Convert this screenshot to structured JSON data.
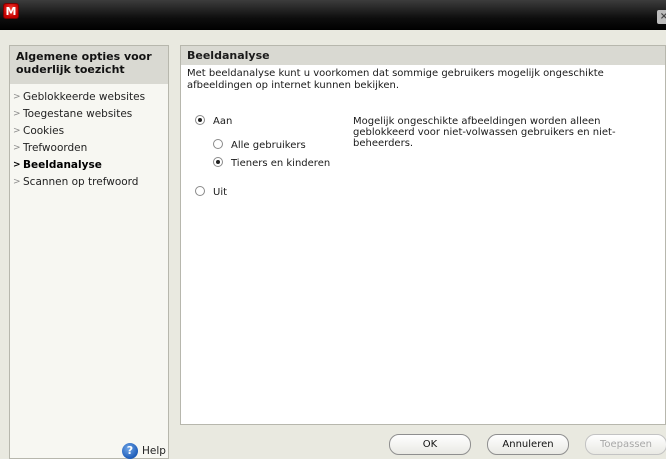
{
  "titlebar": {
    "logo": "M",
    "close": "×"
  },
  "sidebar": {
    "header": "Algemene opties voor ouderlijk toezicht",
    "items": [
      {
        "label": "Geblokkeerde websites"
      },
      {
        "label": "Toegestane websites"
      },
      {
        "label": "Cookies"
      },
      {
        "label": "Trefwoorden"
      },
      {
        "label": "Beeldanalyse"
      },
      {
        "label": "Scannen op trefwoord"
      }
    ],
    "active_item": "Beeldanalyse",
    "help": "Help"
  },
  "panel": {
    "title": "Beeldanalyse",
    "description": "Met beeldanalyse kunt u voorkomen dat sommige gebruikers mogelijk ongeschikte afbeeldingen op internet kunnen bekijken.",
    "on_label": "Aan",
    "on_selected": true,
    "on_info": "Mogelijk ongeschikte afbeeldingen worden alleen geblokkeerd voor niet-volwassen gebruikers en niet-beheerders.",
    "scope_options": [
      {
        "label": "Alle gebruikers",
        "selected": false
      },
      {
        "label": "Tieners en kinderen",
        "selected": true
      }
    ],
    "off_label": "Uit",
    "off_selected": false
  },
  "buttons": {
    "ok": "OK",
    "cancel": "Annuleren",
    "apply": "Toepassen",
    "apply_enabled": false
  },
  "colors": {
    "brand": "#c40000",
    "header_bg": "#d9d9d2",
    "window_bg": "#e9e9e0"
  },
  "icons": {
    "logo": "mcafee-logo-icon",
    "help": "help-icon",
    "chevron": "chevron-right-icon",
    "close": "close-icon"
  }
}
